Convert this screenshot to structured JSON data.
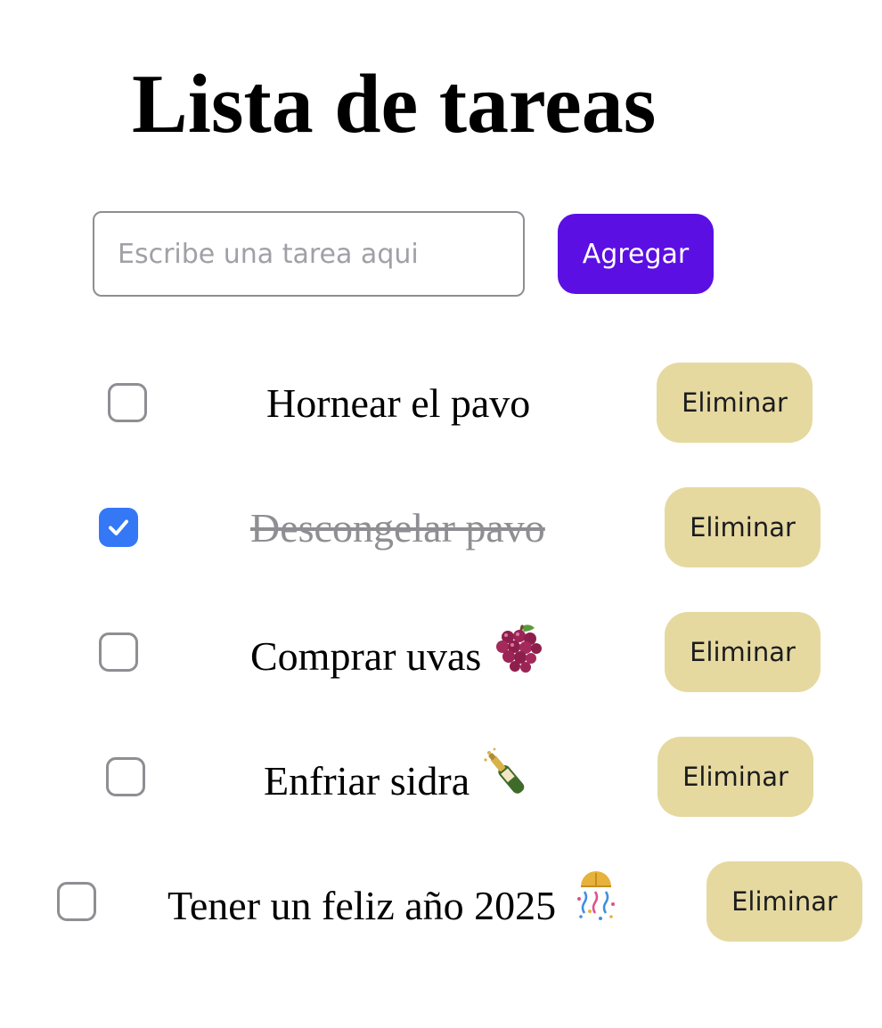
{
  "header": {
    "title": "Lista de tareas"
  },
  "form": {
    "input_placeholder": "Escribe una tarea aqui",
    "input_value": "",
    "add_label": "Agregar"
  },
  "tasks": [
    {
      "text": "Hornear el pavo",
      "done": false,
      "emoji": "",
      "delete_label": "Eliminar"
    },
    {
      "text": "Descongelar pavo",
      "done": true,
      "emoji": "",
      "delete_label": "Eliminar"
    },
    {
      "text": "Comprar uvas",
      "done": false,
      "emoji": "grapes-icon",
      "delete_label": "Eliminar"
    },
    {
      "text": "Enfriar sidra",
      "done": false,
      "emoji": "champagne-bottle-icon",
      "delete_label": "Eliminar"
    },
    {
      "text": "Tener un feliz año 2025",
      "done": false,
      "emoji": "confetti-ball-icon",
      "delete_label": "Eliminar"
    }
  ],
  "colors": {
    "accent": "#5b0fe3",
    "delete_bg": "#e5d9a0",
    "checkbox_checked": "#3478f6",
    "checkbox_border": "#8e8e93",
    "done_text": "#8e8e93"
  }
}
